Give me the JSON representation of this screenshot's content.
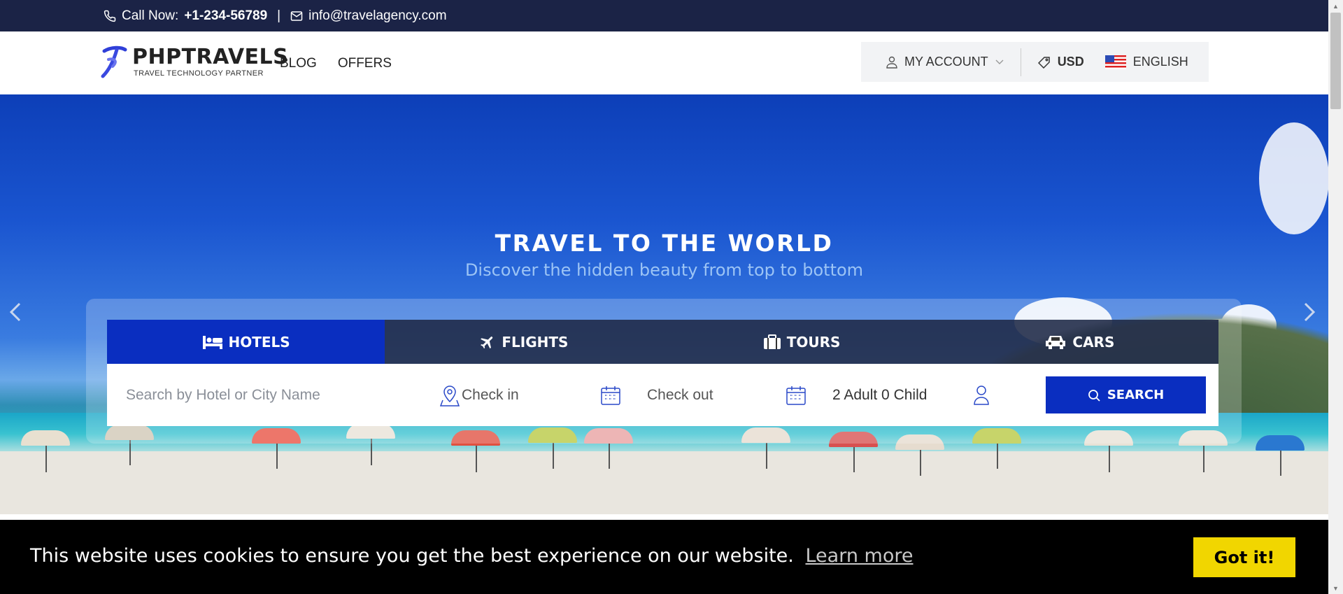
{
  "topbar": {
    "call_label": "Call Now:",
    "phone": "+1-234-56789",
    "separator": "|",
    "email": "info@travelagency.com"
  },
  "header": {
    "logo_title": "PHPTRAVELS",
    "logo_subtitle": "TRAVEL TECHNOLOGY PARTNER",
    "nav": [
      "BLOG",
      "OFFERS"
    ],
    "account_label": "MY ACCOUNT",
    "currency": "USD",
    "language": "ENGLISH"
  },
  "hero": {
    "title": "TRAVEL TO THE WORLD",
    "subtitle": "Discover the hidden beauty from top to bottom"
  },
  "tabs": [
    {
      "label": "HOTELS",
      "icon": "bed-icon",
      "active": true
    },
    {
      "label": "FLIGHTS",
      "icon": "plane-icon",
      "active": false
    },
    {
      "label": "TOURS",
      "icon": "suitcase-icon",
      "active": false
    },
    {
      "label": "CARS",
      "icon": "car-icon",
      "active": false
    }
  ],
  "search_form": {
    "hotel_placeholder": "Search by Hotel or City Name",
    "checkin_placeholder": "Check in",
    "checkout_placeholder": "Check out",
    "guests": "2 Adult 0 Child",
    "search_button": "SEARCH"
  },
  "cookie": {
    "message": "This website uses cookies to ensure you get the best experience on our website.",
    "learn_more": "Learn more",
    "accept": "Got it!"
  },
  "colors": {
    "topbar_bg": "#1b2346",
    "primary": "#0a2ec0",
    "cookie_button": "#f1d600"
  }
}
